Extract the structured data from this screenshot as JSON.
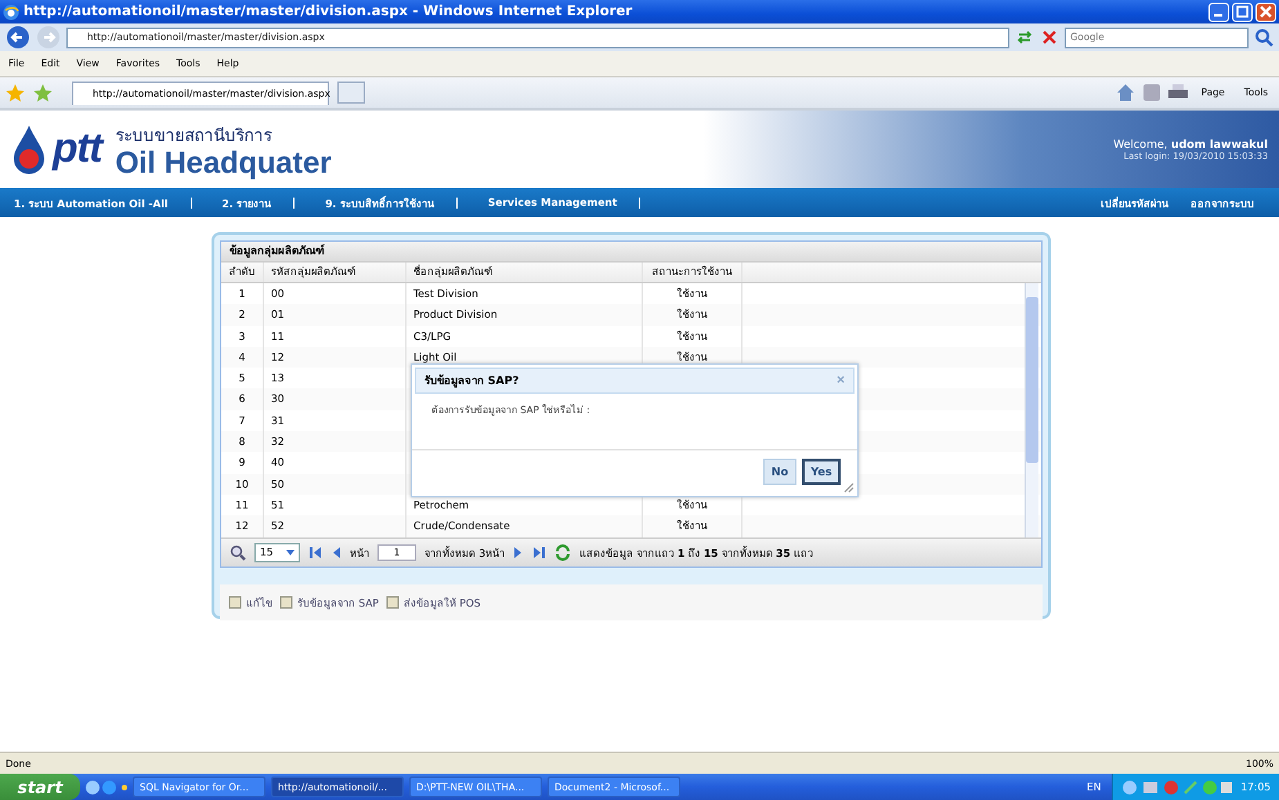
{
  "window": {
    "title": "http://automationoil/master/master/division.aspx - Windows Internet Explorer"
  },
  "browser": {
    "address": "http://automationoil/master/master/division.aspx",
    "search_placeholder": "Google",
    "menu": [
      "File",
      "Edit",
      "View",
      "Favorites",
      "Tools",
      "Help"
    ],
    "tab": "http://automationoil/master/master/division.aspx",
    "commands": [
      "Page",
      "Tools"
    ]
  },
  "header": {
    "logo": "ptt",
    "subtitle": "ระบบขายสถานีบริการ",
    "title": "Oil Headquater",
    "welcome": "Welcome, **udom lawwakul**",
    "last_login": "Last login: 19/03/2010 15:03:33"
  },
  "nav": {
    "left": [
      "1. ระบบ Automation Oil -All",
      "2. รายงาน",
      "9. ระบบสิทธิ์การใช้งาน",
      "Services Management"
    ],
    "right": [
      "เปลี่ยนรหัสผ่าน",
      "ออกจากระบบ"
    ]
  },
  "grid": {
    "title": "ข้อมูลกลุ่มผลิตภัณฑ์",
    "columns": [
      "ลำดับ",
      "รหัสกลุ่มผลิตภัณฑ์",
      "ชื่อกลุ่มผลิตภัณฑ์",
      "สถานะการใช้งาน"
    ],
    "rows": [
      {
        "no": "1",
        "code": "00",
        "name": "Test Division",
        "status": "ใช้งาน"
      },
      {
        "no": "2",
        "code": "01",
        "name": "Product Division",
        "status": "ใช้งาน"
      },
      {
        "no": "3",
        "code": "11",
        "name": "C3/LPG",
        "status": "ใช้งาน"
      },
      {
        "no": "4",
        "code": "12",
        "name": "Light Oil",
        "status": "ใช้งาน"
      },
      {
        "no": "5",
        "code": "13"
      },
      {
        "no": "6",
        "code": "30"
      },
      {
        "no": "7",
        "code": "31"
      },
      {
        "no": "8",
        "code": "32"
      },
      {
        "no": "9",
        "code": "40"
      },
      {
        "no": "10",
        "code": "50"
      },
      {
        "no": "11",
        "code": "51",
        "name": "Petrochem",
        "status": "ใช้งาน"
      },
      {
        "no": "12",
        "code": "52",
        "name": "Crude/Condensate",
        "status": "ใช้งาน"
      }
    ],
    "pager": {
      "page_size": "15",
      "page_label": "หน้า",
      "page": "1",
      "of_pages": "จากทั้งหมด 3หน้า",
      "info": "แสดงข้อมูล จากแถว **1** ถึง **15** จากทั้งหมด **35** แถว"
    },
    "actions": [
      "แก้ไข",
      "รับข้อมูลจาก SAP",
      "ส่งข้อมูลให้ POS"
    ]
  },
  "dialog": {
    "title": "รับข้อมูลจาก SAP?",
    "close": "×",
    "message": "ต้องการรับข้อมูลจาก SAP ใช่หรือไม่ :",
    "buttons": [
      {
        "label": "No",
        "selected": false
      },
      {
        "label": "Yes",
        "selected": true
      }
    ]
  },
  "status_bar": {
    "text": "Done",
    "zoom": "100%"
  },
  "taskbar": {
    "start": "start",
    "tasks": [
      {
        "label": "SQL Navigator for Or...",
        "selected": false
      },
      {
        "label": "http://automationoil/...",
        "selected": true
      },
      {
        "label": "D:\\PTT-NEW OIL\\THA...",
        "selected": false
      },
      {
        "label": "Document2 - Microsof...",
        "selected": false
      }
    ],
    "language": "EN",
    "time": "17:05"
  }
}
